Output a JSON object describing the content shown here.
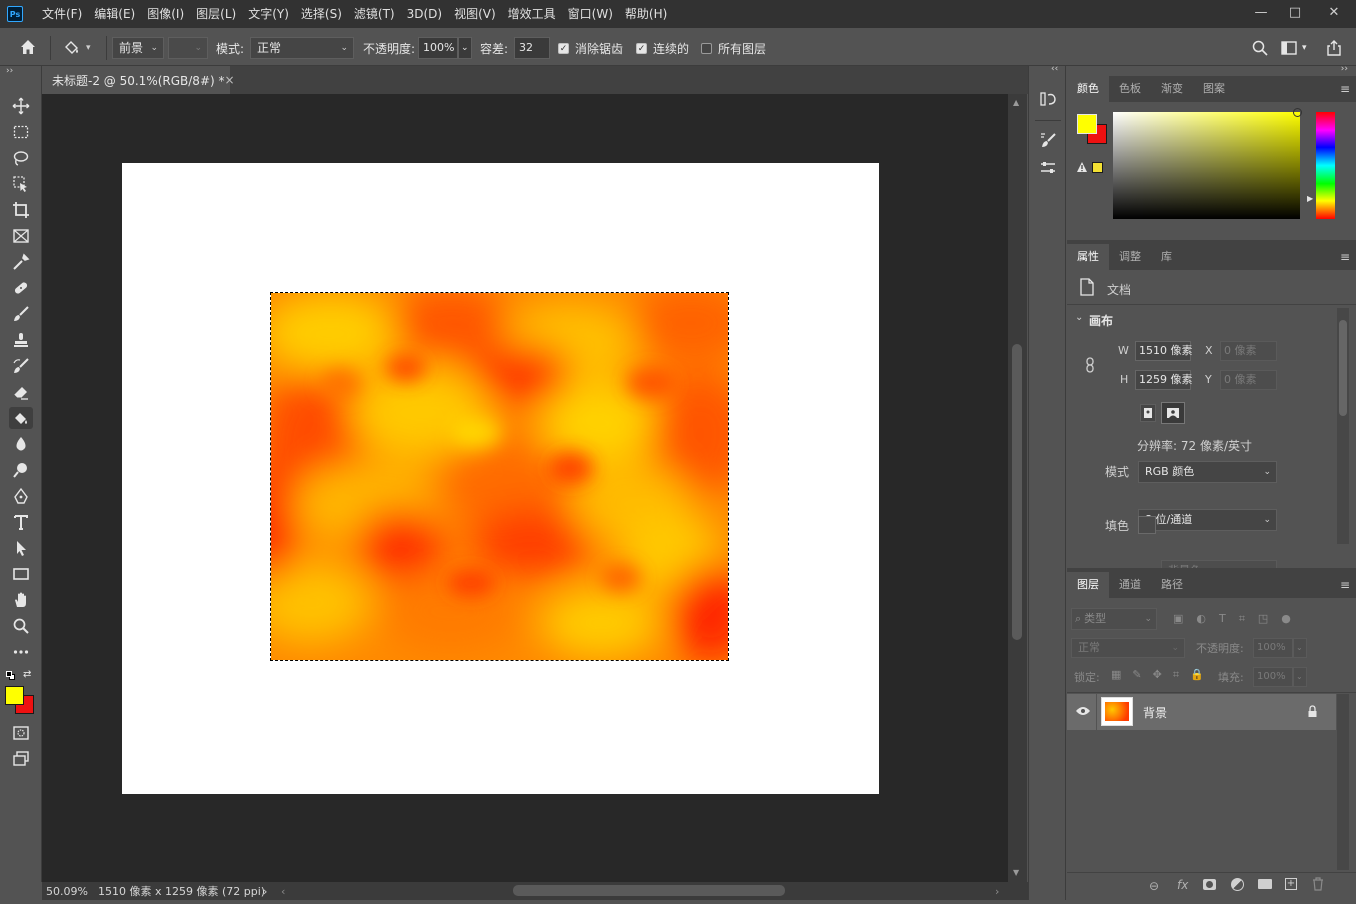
{
  "app": {
    "logo": "Ps"
  },
  "menu": [
    "文件(F)",
    "编辑(E)",
    "图像(I)",
    "图层(L)",
    "文字(Y)",
    "选择(S)",
    "滤镜(T)",
    "3D(D)",
    "视图(V)",
    "增效工具",
    "窗口(W)",
    "帮助(H)"
  ],
  "window_controls": {
    "minimize": "—",
    "restore": "□",
    "close": "✕"
  },
  "options": {
    "fill_source": "前景",
    "mode_label": "模式:",
    "mode_value": "正常",
    "opacity_label": "不透明度:",
    "opacity_value": "100%",
    "tolerance_label": "容差:",
    "tolerance_value": "32",
    "antialias_label": "消除锯齿",
    "antialias_checked": true,
    "contiguous_label": "连续的",
    "contiguous_checked": true,
    "all_layers_label": "所有图层",
    "all_layers_checked": false
  },
  "document": {
    "tab_title": "未标题-2 @ 50.1%(RGB/8#) *",
    "tab_close": "×"
  },
  "status": {
    "zoom": "50.09%",
    "info": "1510 像素 x 1259 像素 (72 ppi)",
    "arrow": "›"
  },
  "colors": {
    "foreground": "#ffff00",
    "background": "#ee1111",
    "canvas_bg": "#282828",
    "cloud_orange": "#ff7a00",
    "cloud_red": "#ff2a00",
    "cloud_yellow": "#ffd000"
  },
  "color_panel": {
    "tabs": [
      "颜色",
      "色板",
      "渐变",
      "图案"
    ]
  },
  "properties_panel": {
    "tabs": [
      "属性",
      "调整",
      "库"
    ],
    "doc_label": "文档",
    "section": "画布",
    "w_label": "W",
    "w_value": "1510 像素",
    "h_label": "H",
    "h_value": "1259 像素",
    "x_label": "X",
    "x_value": "0 像素",
    "y_label": "Y",
    "y_value": "0 像素",
    "resolution": "分辨率: 72 像素/英寸",
    "mode_label": "模式",
    "mode_value": "RGB 颜色",
    "depth_value": "8 位/通道",
    "fill_label": "填色",
    "fill_value": "背景色"
  },
  "layers_panel": {
    "tabs": [
      "图层",
      "通道",
      "路径"
    ],
    "filter_placeholder": "类型",
    "blend_mode": "正常",
    "opacity_label": "不透明度:",
    "opacity_value": "100%",
    "lock_label": "锁定:",
    "fill_label": "填充:",
    "fill_value": "100%",
    "layers": [
      {
        "name": "背景",
        "visible": true,
        "locked": true
      }
    ],
    "footer_fx": "fx"
  }
}
